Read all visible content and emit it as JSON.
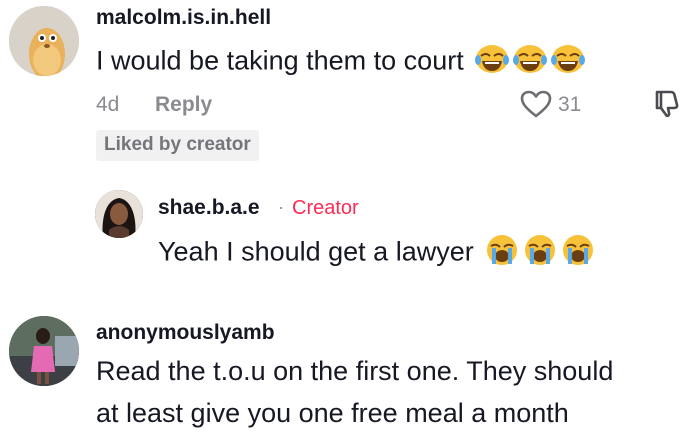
{
  "comments": [
    {
      "username": "malcolm.is.in.hell",
      "text": "I would be taking them to court",
      "emojis": [
        "laughing-crying-emoji",
        "laughing-crying-emoji",
        "laughing-crying-emoji"
      ],
      "age": "4d",
      "reply_label": "Reply",
      "likes": "31",
      "badge": "Liked by creator",
      "avatar_icon": "duck-avatar-icon"
    },
    {
      "username": "shae.b.a.e",
      "separator": "·",
      "creator_label": "Creator",
      "text": "Yeah I should get a lawyer",
      "emojis": [
        "loudly-crying-emoji",
        "loudly-crying-emoji",
        "loudly-crying-emoji"
      ],
      "avatar_icon": "profile-photo-icon"
    },
    {
      "username": "anonymouslyamb",
      "text_line1": "Read the t.o.u on the first one. They should",
      "text_line2": "at least give you one free meal a month",
      "avatar_icon": "profile-photo-icon"
    }
  ],
  "icons": {
    "heart": "heart-outline-icon",
    "dislike": "thumbs-down-icon"
  },
  "colors": {
    "text": "#161823",
    "muted": "#8a8b91",
    "creator": "#fe2c55",
    "badge_bg": "#f1f1f2"
  }
}
